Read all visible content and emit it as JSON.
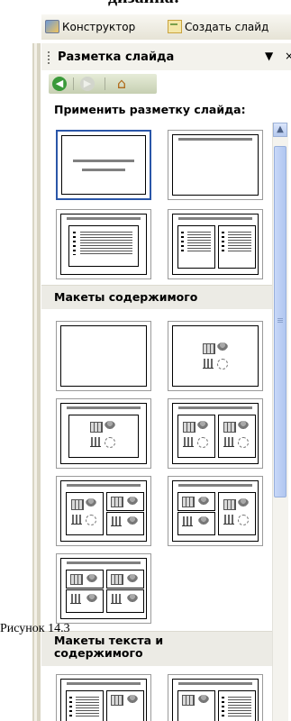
{
  "heading": "дизайна:",
  "toolbar": {
    "designer": "Конструктор",
    "new_slide": "Создать слайд"
  },
  "task_pane": {
    "title": "Разметка слайда",
    "menu_arrow": "▼",
    "close": "×",
    "apply_label": "Применить разметку слайда:",
    "sections": [
      "Макеты содержимого",
      "Макеты текста и содержимого"
    ]
  },
  "caption": "Рисунок 14.3"
}
